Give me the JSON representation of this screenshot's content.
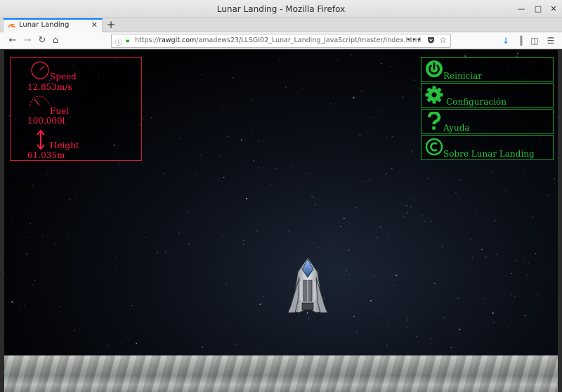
{
  "window": {
    "title": "Lunar Landing - Mozilla Firefox"
  },
  "tabs": [
    {
      "label": "Lunar Landing"
    }
  ],
  "navbar": {
    "url_prefix": "https://",
    "url_domain": "rawgit.com",
    "url_path": "/amadews23/LLSGI02_Lunar_Landing_JavaScript/master/index.html",
    "more_label": "•••"
  },
  "hud": {
    "speed_label": "Speed",
    "speed_value": "12.853m/s",
    "fuel_label": "Fuel",
    "fuel_value": "100.000l",
    "height_label": "Height",
    "height_value": "61.035m",
    "color": "#ff1a4a"
  },
  "menu": {
    "color": "#27c23d",
    "items": [
      {
        "label": "Reiniciar",
        "icon": "power-icon"
      },
      {
        "label": "Configuración",
        "icon": "gear-icon"
      },
      {
        "label": "Ayuda",
        "icon": "question-icon"
      },
      {
        "label": "Sobre Lunar Landing",
        "icon": "copyright-icon"
      }
    ]
  }
}
